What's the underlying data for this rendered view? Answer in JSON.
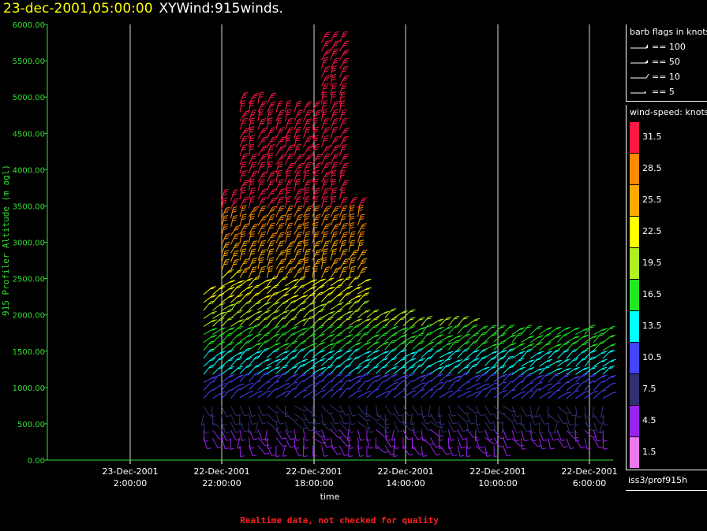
{
  "header": {
    "datetime": "23-dec-2001,05:00:00",
    "product": "XYWind:915winds."
  },
  "chart_data": {
    "type": "wind-barb time-height",
    "ylabel": "915 Profiler Altitude (m agl)",
    "xlabel": "time",
    "ylim": [
      0,
      6000
    ],
    "y_ticks": [
      "0.00",
      "500.00",
      "1000.00",
      "1500.00",
      "2000.00",
      "2500.00",
      "3000.00",
      "3500.00",
      "4000.00",
      "4500.00",
      "5000.00",
      "5500.00",
      "6000.00"
    ],
    "x_ticks": [
      {
        "date": "23-Dec-2001",
        "time": "2:00:00"
      },
      {
        "date": "22-Dec-2001",
        "time": "22:00:00"
      },
      {
        "date": "22-Dec-2001",
        "time": "18:00:00"
      },
      {
        "date": "22-Dec-2001",
        "time": "14:00:00"
      },
      {
        "date": "22-Dec-2001",
        "time": "10:00:00"
      },
      {
        "date": "22-Dec-2001",
        "time": "6:00:00"
      }
    ],
    "x_axis_direction": "time decreasing to the right",
    "grid": "vertical lines at time ticks",
    "colorbar": {
      "title": "wind-speed: knots",
      "levels": [
        "31.5",
        "28.5",
        "25.5",
        "22.5",
        "19.5",
        "16.5",
        "13.5",
        "10.5",
        "7.5",
        "4.5",
        "1.5"
      ],
      "colors": [
        "#ff1744",
        "#ff8800",
        "#ffaa00",
        "#ffff00",
        "#b0f020",
        "#22e822",
        "#00ffff",
        "#4444ff",
        "#303070",
        "#9922ee",
        "#ee77ee"
      ]
    }
  },
  "legend": {
    "title": "barb flags in knots",
    "flags": [
      "== 100",
      "== 50",
      "== 10",
      "== 5"
    ]
  },
  "platform": "iss3/prof915h",
  "footer": "Realtime data, not checked for quality"
}
